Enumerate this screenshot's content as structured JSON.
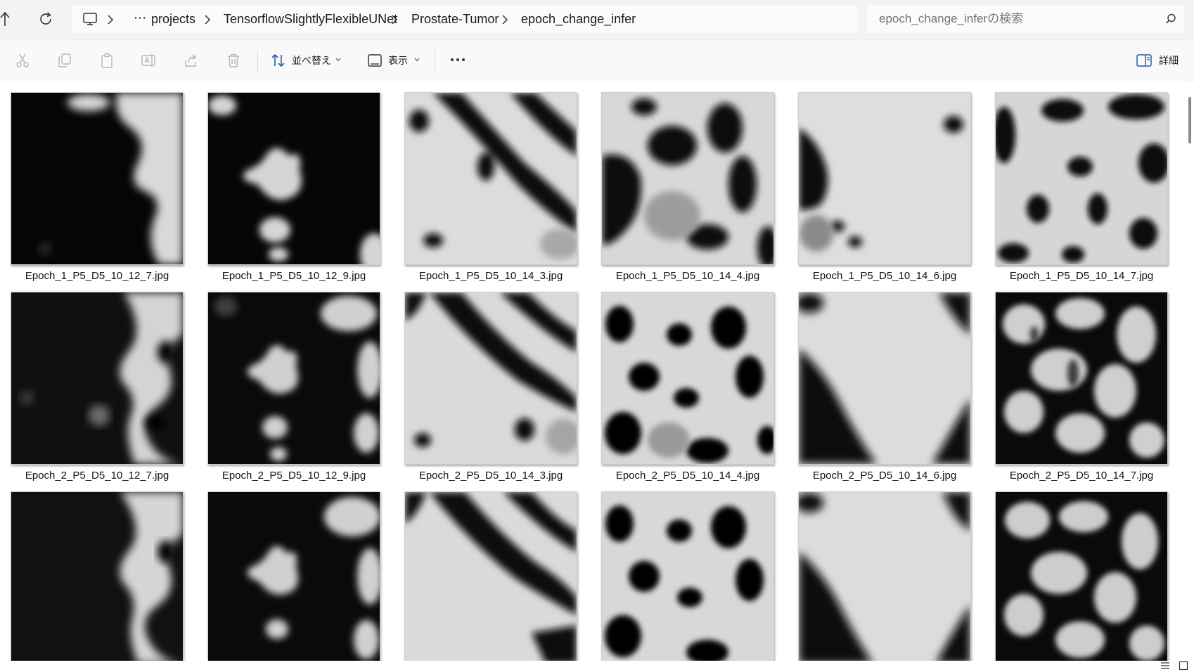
{
  "address": {
    "overflow_label": "⋯",
    "crumbs": [
      "projects",
      "TensorflowSlightlyFlexibleUNet",
      "Prostate-Tumor",
      "epoch_change_infer"
    ]
  },
  "search": {
    "placeholder": "epoch_change_inferの検索"
  },
  "toolbar": {
    "sort_label": "並べ替え",
    "view_label": "表示",
    "details_label": "詳細"
  },
  "files": [
    "Epoch_1_P5_D5_10_12_7.jpg",
    "Epoch_1_P5_D5_10_12_9.jpg",
    "Epoch_1_P5_D5_10_14_3.jpg",
    "Epoch_1_P5_D5_10_14_4.jpg",
    "Epoch_1_P5_D5_10_14_6.jpg",
    "Epoch_1_P5_D5_10_14_7.jpg",
    "Epoch_2_P5_D5_10_12_7.jpg",
    "Epoch_2_P5_D5_10_12_9.jpg",
    "Epoch_2_P5_D5_10_14_3.jpg",
    "Epoch_2_P5_D5_10_14_4.jpg",
    "Epoch_2_P5_D5_10_14_6.jpg",
    "Epoch_2_P5_D5_10_14_7.jpg"
  ]
}
